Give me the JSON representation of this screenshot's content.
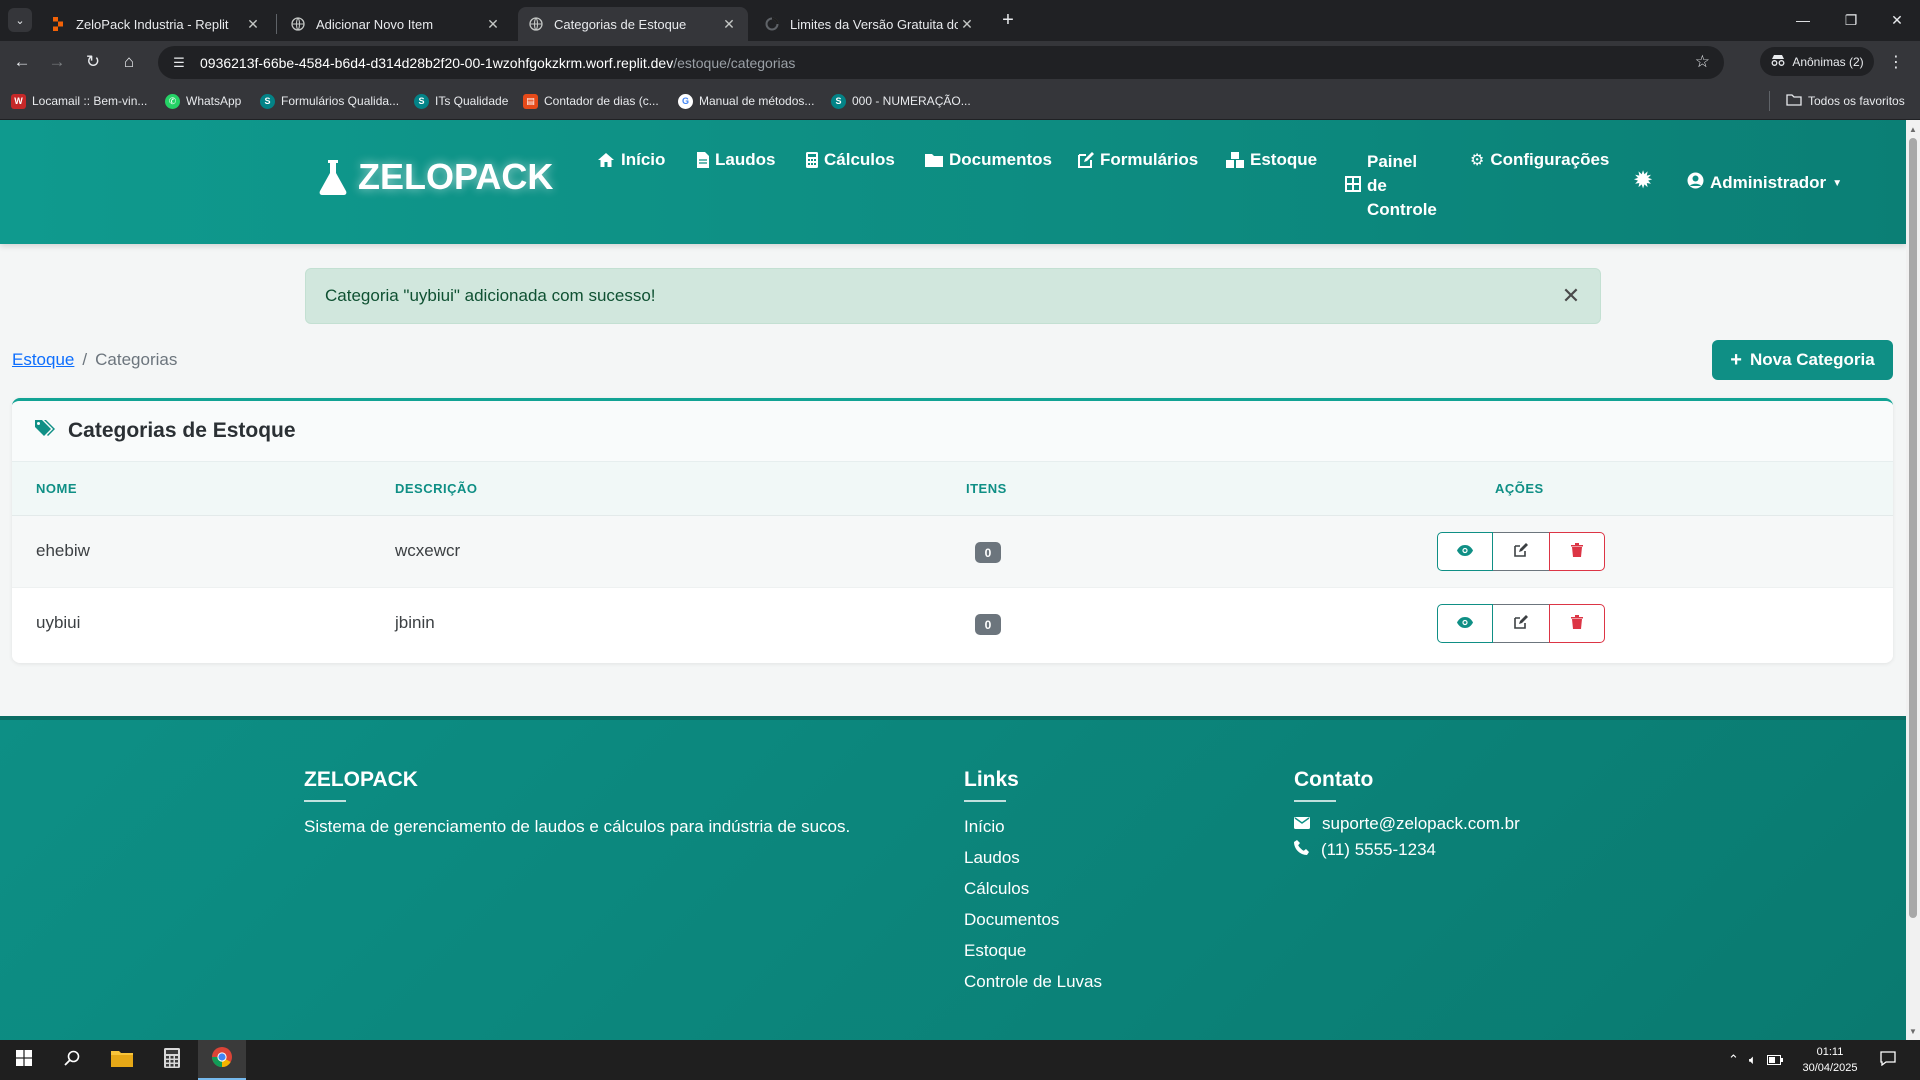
{
  "browser": {
    "tabs": [
      {
        "title": "ZeloPack Industria - Replit",
        "active": false
      },
      {
        "title": "Adicionar Novo Item",
        "active": false
      },
      {
        "title": "Categorias de Estoque",
        "active": true
      },
      {
        "title": "Limites da Versão Gratuita do G",
        "active": false
      }
    ],
    "url_host": "0936213f-66be-4584-b6d4-d314d28b2f20-00-1wzohfgokzkrm.worf.replit.dev",
    "url_path": "/estoque/categorias",
    "profile_label": "Anônimas (2)",
    "bookmarks": [
      {
        "label": "Locamail :: Bem-vin...",
        "icon": "locamail-icon",
        "color": "#c62828"
      },
      {
        "label": "WhatsApp",
        "icon": "whatsapp-icon",
        "color": "#25d366"
      },
      {
        "label": "Formulários Qualida...",
        "icon": "sharepoint-icon",
        "color": "#038387"
      },
      {
        "label": "ITs Qualidade",
        "icon": "sharepoint-icon",
        "color": "#038387"
      },
      {
        "label": "Contador de dias (c...",
        "icon": "calendar-icon",
        "color": "#e64a19"
      },
      {
        "label": "Manual de métodos...",
        "icon": "google-icon",
        "color": "#ffffff"
      },
      {
        "label": "000 - NUMERAÇÃO...",
        "icon": "sharepoint-icon",
        "color": "#038387"
      }
    ],
    "all_bookmarks_label": "Todos os favoritos"
  },
  "site": {
    "brand": "ZELOPACK",
    "nav": [
      {
        "label": "Início",
        "icon": "home-icon"
      },
      {
        "label": "Laudos",
        "icon": "file-icon"
      },
      {
        "label": "Cálculos",
        "icon": "calculator-icon"
      },
      {
        "label": "Documentos",
        "icon": "folder-icon"
      },
      {
        "label": "Formulários",
        "icon": "edit-icon"
      },
      {
        "label": "Estoque",
        "icon": "boxes-icon"
      }
    ],
    "painel_lines": [
      "Painel",
      "de",
      "Controle"
    ],
    "config_label": "Configurações",
    "user_label": "Administrador",
    "accent": "#0f8f85"
  },
  "alert": {
    "message": "Categoria \"uybiui\" adicionada com sucesso!"
  },
  "breadcrumb": {
    "parent": "Estoque",
    "separator": "/",
    "current": "Categorias"
  },
  "new_button_label": "Nova Categoria",
  "card": {
    "title": "Categorias de Estoque",
    "columns": [
      "NOME",
      "DESCRIÇÃO",
      "ITENS",
      "AÇÕES"
    ],
    "rows": [
      {
        "nome": "ehebiw",
        "descricao": "wcxewcr",
        "itens": "0"
      },
      {
        "nome": "uybiui",
        "descricao": "jbinin",
        "itens": "0"
      }
    ]
  },
  "footer": {
    "brand": "ZELOPACK",
    "tagline": "Sistema de gerenciamento de laudos e cálculos para indústria de sucos.",
    "links_title": "Links",
    "links": [
      "Início",
      "Laudos",
      "Cálculos",
      "Documentos",
      "Estoque",
      "Controle de Luvas"
    ],
    "contact_title": "Contato",
    "email": "suporte@zelopack.com.br",
    "phone": "(11) 5555-1234"
  },
  "taskbar": {
    "time": "01:11",
    "date": "30/04/2025"
  }
}
